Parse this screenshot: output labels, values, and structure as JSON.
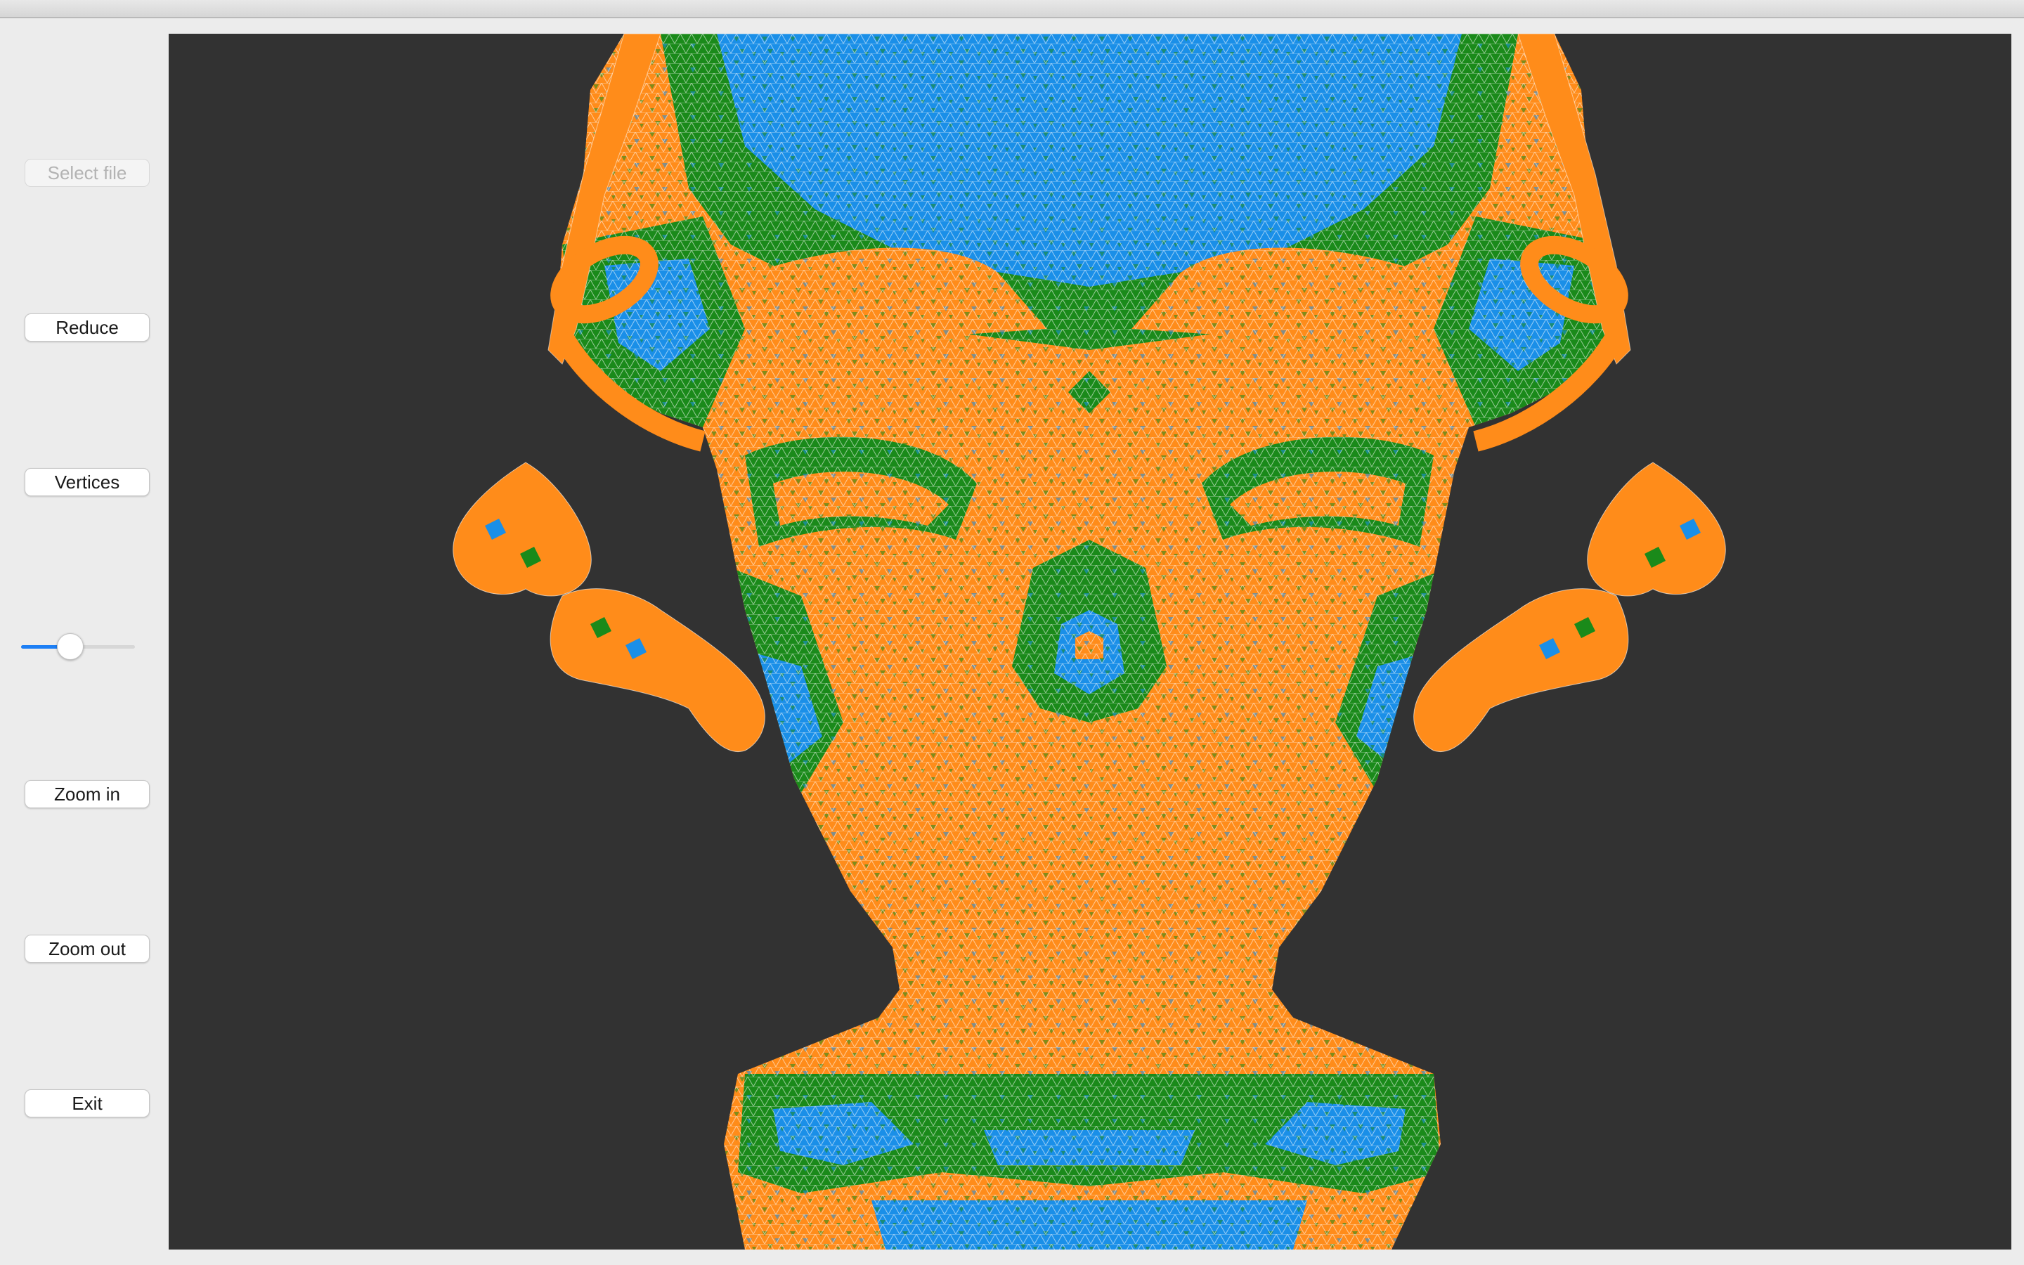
{
  "sidebar": {
    "buttons": [
      {
        "id": "select-file",
        "label": "Select file",
        "enabled": false
      },
      {
        "id": "reduce",
        "label": "Reduce",
        "enabled": true
      },
      {
        "id": "vertices",
        "label": "Vertices",
        "enabled": true
      },
      {
        "id": "zoom-in",
        "label": "Zoom in",
        "enabled": true
      },
      {
        "id": "zoom-out",
        "label": "Zoom out",
        "enabled": true
      },
      {
        "id": "exit",
        "label": "Exit",
        "enabled": true
      }
    ],
    "slider": {
      "value": 0.41,
      "accent": "#1d7ff5"
    }
  },
  "viewport": {
    "content": "wireframe-mesh-head",
    "background": "#323232",
    "colors": {
      "orange": "#ff8c1a",
      "green": "#1a8a1a",
      "blue": "#1a8fe8",
      "wire": "#ffffff"
    }
  }
}
